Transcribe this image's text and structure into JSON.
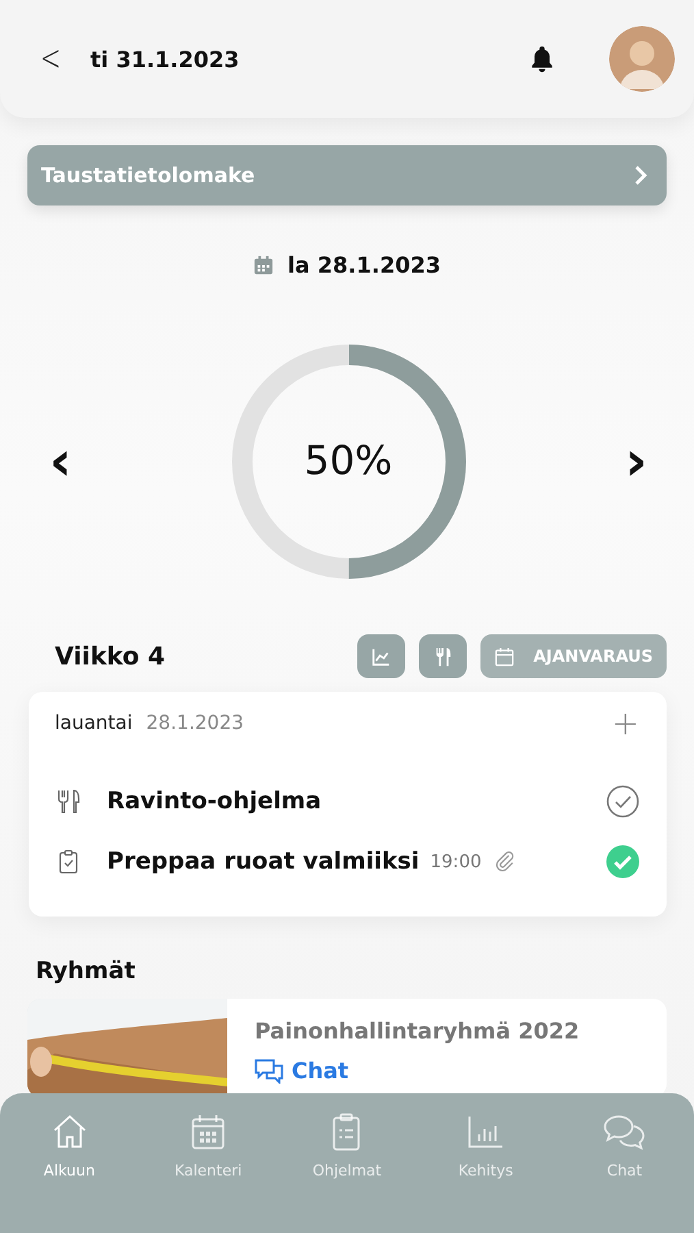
{
  "header": {
    "back": "<",
    "date": "ti 31.1.2023"
  },
  "banner": {
    "label": "Taustatietolomake"
  },
  "day": {
    "date": "la 28.1.2023"
  },
  "progress": {
    "level": 0.5,
    "reading": "50%",
    "prev": "‹",
    "next": "›"
  },
  "week": {
    "title": "Viikko 4",
    "booking": "AJANVARAUS"
  },
  "agenda": {
    "weekday": "lauantai",
    "date": "28.1.2023",
    "add": "+",
    "items": [
      {
        "kind": "nutrition",
        "title": "Ravinto-ohjelma",
        "done": false
      },
      {
        "kind": "task",
        "title": "Preppaa ruoat valmiiksi",
        "time": "19:00",
        "attachment": true,
        "done": true
      }
    ]
  },
  "groups": {
    "title": "Ryhmät",
    "items": [
      {
        "name": "Painonhallintaryhmä 2022",
        "link": "Chat"
      }
    ]
  },
  "nav": [
    {
      "kind": "home",
      "label": "Alkuun",
      "selected": true
    },
    {
      "kind": "calendar",
      "label": "Kalenteri",
      "selected": false
    },
    {
      "kind": "clipboard",
      "label": "Ohjelmat",
      "selected": false
    },
    {
      "kind": "chart",
      "label": "Kehitys",
      "selected": false
    },
    {
      "kind": "chat",
      "label": "Chat",
      "selected": false
    }
  ]
}
